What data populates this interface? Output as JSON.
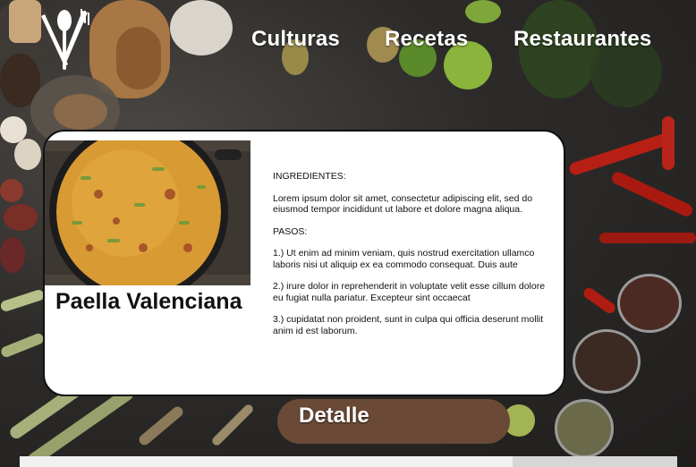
{
  "nav": {
    "items": [
      {
        "label": "Culturas"
      },
      {
        "label": "Recetas"
      },
      {
        "label": "Restaurantes"
      }
    ]
  },
  "logo": {
    "icon": "fork-knife-spoon-icon"
  },
  "card": {
    "title": "Paella Valenciana",
    "photo_icon": "paella-pan-image",
    "ingredients_heading": "INGREDIENTES:",
    "ingredients_text": "Lorem ipsum dolor sit amet, consectetur adipiscing elit, sed do eiusmod tempor incididunt ut labore et dolore magna aliqua.",
    "steps_heading": "PASOS:",
    "steps": [
      "1.) Ut enim ad minim veniam, quis nostrud exercitation ullamco laboris nisi ut aliquip ex ea commodo consequat. Duis aute",
      "2.) irure dolor in reprehenderit in voluptate velit esse cillum dolore eu fugiat nulla pariatur. Excepteur sint occaecat",
      "3.) cupidatat non proident, sunt in culpa qui officia deserunt mollit anim id est laborum."
    ]
  },
  "detail_label": "Detalle",
  "colors": {
    "card_bg": "#ffffff",
    "card_border": "#111111",
    "nav_text": "#ffffff",
    "background": "#2d2b29"
  }
}
